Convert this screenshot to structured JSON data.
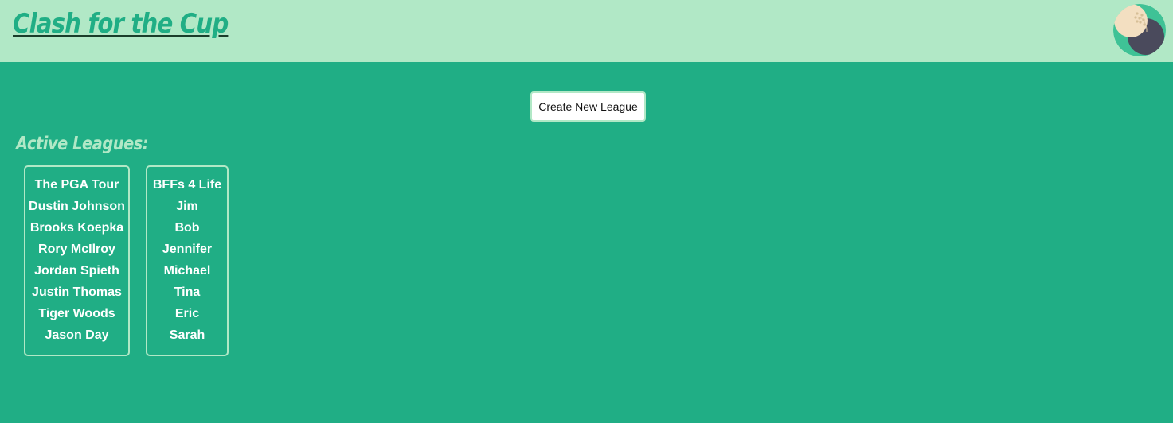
{
  "header": {
    "title": "Clash for the Cup",
    "avatar_icon": "golf-ball-icon"
  },
  "actions": {
    "create_league_label": "Create New League"
  },
  "active_leagues": {
    "heading": "Active Leagues:",
    "leagues": [
      {
        "name": "The PGA Tour",
        "members": [
          "Dustin Johnson",
          "Brooks Koepka",
          "Rory McIlroy",
          "Jordan Spieth",
          "Justin Thomas",
          "Tiger Woods",
          "Jason Day"
        ]
      },
      {
        "name": "BFFs 4 Life",
        "members": [
          "Jim",
          "Bob",
          "Jennifer",
          "Michael",
          "Tina",
          "Eric",
          "Sarah"
        ]
      }
    ]
  },
  "colors": {
    "background": "#20ae85",
    "header_background": "#b1e8c6",
    "accent": "#b1e8c6",
    "text": "#ffffff"
  }
}
